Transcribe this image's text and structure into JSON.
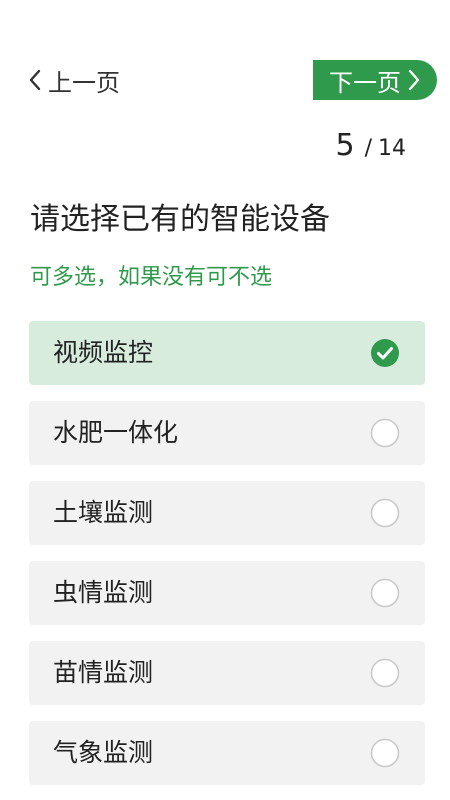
{
  "nav": {
    "prev_label": "上一页",
    "next_label": "下一页"
  },
  "pager": {
    "current": "5",
    "separator": "/",
    "total": "14"
  },
  "question": {
    "title": "请选择已有的智能设备",
    "hint": "可多选，如果没有可不选"
  },
  "options": [
    {
      "label": "视频监控",
      "selected": true
    },
    {
      "label": "水肥一体化",
      "selected": false
    },
    {
      "label": "土壤监测",
      "selected": false
    },
    {
      "label": "虫情监测",
      "selected": false
    },
    {
      "label": "苗情监测",
      "selected": false
    },
    {
      "label": "气象监测",
      "selected": false
    }
  ],
  "colors": {
    "accent": "#2f9a4b",
    "selected_bg": "#d8ecdd",
    "option_bg": "#f2f2f2",
    "radio_border": "#c8c8c8"
  },
  "icons": {
    "prev": "chevron-left-icon",
    "next": "chevron-right-icon",
    "checked": "check-circle-icon",
    "unchecked": "radio-circle-icon"
  }
}
